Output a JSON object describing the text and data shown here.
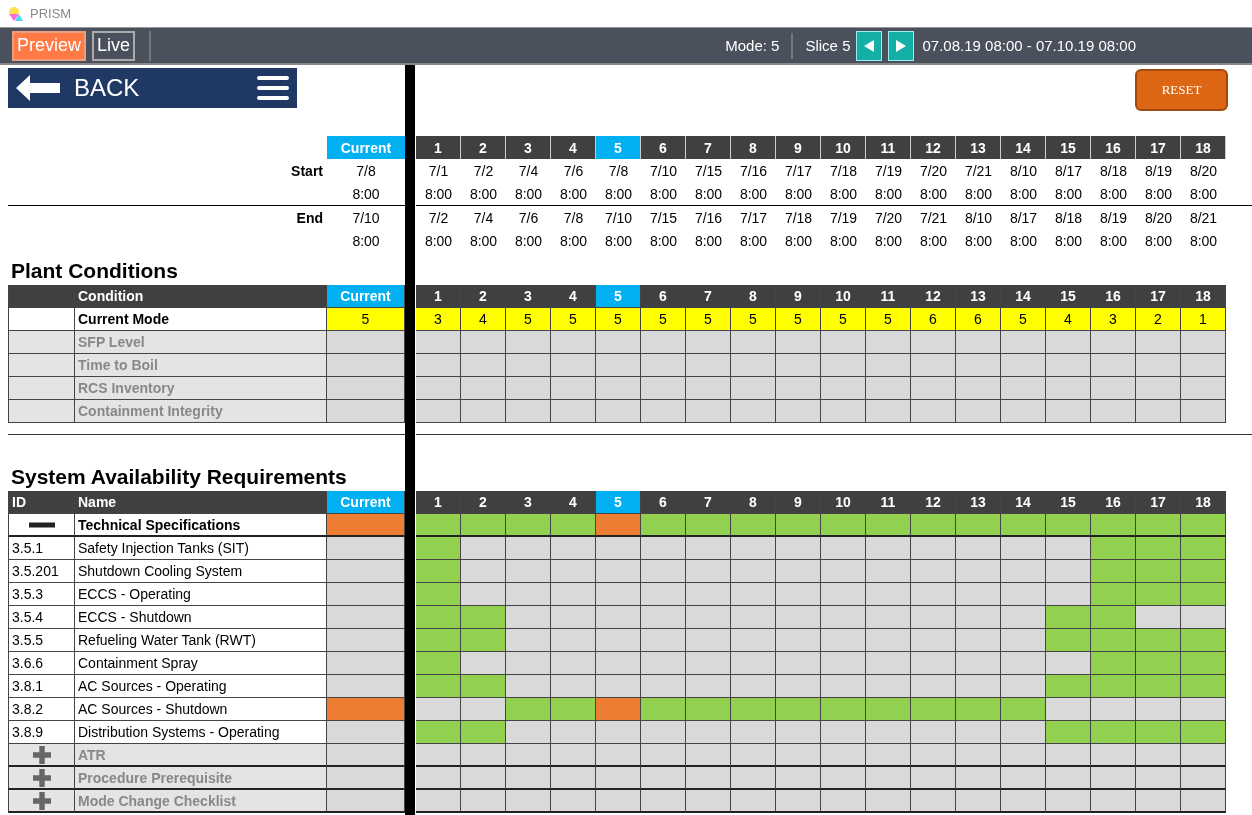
{
  "app": {
    "title": "PRISM"
  },
  "toolbar": {
    "modes": [
      {
        "label": "Preview",
        "selected": true
      },
      {
        "label": "Live",
        "selected": false
      }
    ],
    "mode": "Mode: 5",
    "slice": "Slice 5",
    "date_range": "07.08.19 08:00 - 07.10.19 08:00"
  },
  "back_button": "BACK",
  "reset_button": "RESET",
  "slices": {
    "current_label": "Current",
    "columns": [
      {
        "label": "1",
        "selected": false
      },
      {
        "label": "2",
        "selected": false
      },
      {
        "label": "3",
        "selected": false
      },
      {
        "label": "4",
        "selected": false
      },
      {
        "label": "5",
        "selected": true
      },
      {
        "label": "6",
        "selected": false
      },
      {
        "label": "7",
        "selected": false
      },
      {
        "label": "8",
        "selected": false
      },
      {
        "label": "9",
        "selected": false
      },
      {
        "label": "10",
        "selected": false
      },
      {
        "label": "11",
        "selected": false
      },
      {
        "label": "12",
        "selected": false
      },
      {
        "label": "13",
        "selected": false
      },
      {
        "label": "14",
        "selected": false
      },
      {
        "label": "15",
        "selected": false
      },
      {
        "label": "16",
        "selected": false
      },
      {
        "label": "17",
        "selected": false
      },
      {
        "label": "18",
        "selected": false
      }
    ],
    "times": [
      {
        "label": "Start",
        "current": {
          "date": "7/8",
          "time": "8:00"
        },
        "values": [
          {
            "date": "7/1",
            "time": "8:00"
          },
          {
            "date": "7/2",
            "time": "8:00"
          },
          {
            "date": "7/4",
            "time": "8:00"
          },
          {
            "date": "7/6",
            "time": "8:00"
          },
          {
            "date": "7/8",
            "time": "8:00"
          },
          {
            "date": "7/10",
            "time": "8:00"
          },
          {
            "date": "7/15",
            "time": "8:00"
          },
          {
            "date": "7/16",
            "time": "8:00"
          },
          {
            "date": "7/17",
            "time": "8:00"
          },
          {
            "date": "7/18",
            "time": "8:00"
          },
          {
            "date": "7/19",
            "time": "8:00"
          },
          {
            "date": "7/20",
            "time": "8:00"
          },
          {
            "date": "7/21",
            "time": "8:00"
          },
          {
            "date": "8/10",
            "time": "8:00"
          },
          {
            "date": "8/17",
            "time": "8:00"
          },
          {
            "date": "8/18",
            "time": "8:00"
          },
          {
            "date": "8/19",
            "time": "8:00"
          },
          {
            "date": "8/20",
            "time": "8:00"
          }
        ]
      },
      {
        "label": "End",
        "current": {
          "date": "7/10",
          "time": "8:00"
        },
        "values": [
          {
            "date": "7/2",
            "time": "8:00"
          },
          {
            "date": "7/4",
            "time": "8:00"
          },
          {
            "date": "7/6",
            "time": "8:00"
          },
          {
            "date": "7/8",
            "time": "8:00"
          },
          {
            "date": "7/10",
            "time": "8:00"
          },
          {
            "date": "7/15",
            "time": "8:00"
          },
          {
            "date": "7/16",
            "time": "8:00"
          },
          {
            "date": "7/17",
            "time": "8:00"
          },
          {
            "date": "7/18",
            "time": "8:00"
          },
          {
            "date": "7/19",
            "time": "8:00"
          },
          {
            "date": "7/20",
            "time": "8:00"
          },
          {
            "date": "7/21",
            "time": "8:00"
          },
          {
            "date": "8/10",
            "time": "8:00"
          },
          {
            "date": "8/17",
            "time": "8:00"
          },
          {
            "date": "8/18",
            "time": "8:00"
          },
          {
            "date": "8/19",
            "time": "8:00"
          },
          {
            "date": "8/20",
            "time": "8:00"
          },
          {
            "date": "8/21",
            "time": "8:00"
          }
        ]
      }
    ]
  },
  "plant_conditions": {
    "title": "Plant Conditions",
    "header": {
      "condition": "Condition",
      "current": "Current"
    },
    "columns": [
      {
        "label": "1",
        "selected": false
      },
      {
        "label": "2",
        "selected": false
      },
      {
        "label": "3",
        "selected": false
      },
      {
        "label": "4",
        "selected": false
      },
      {
        "label": "5",
        "selected": true
      },
      {
        "label": "6",
        "selected": false
      },
      {
        "label": "7",
        "selected": false
      },
      {
        "label": "8",
        "selected": false
      },
      {
        "label": "9",
        "selected": false
      },
      {
        "label": "10",
        "selected": false
      },
      {
        "label": "11",
        "selected": false
      },
      {
        "label": "12",
        "selected": false
      },
      {
        "label": "13",
        "selected": false
      },
      {
        "label": "14",
        "selected": false
      },
      {
        "label": "15",
        "selected": false
      },
      {
        "label": "16",
        "selected": false
      },
      {
        "label": "17",
        "selected": false
      },
      {
        "label": "18",
        "selected": false
      }
    ],
    "rows": [
      {
        "name": "Current Mode",
        "disabled": false,
        "current": "5",
        "values": [
          "3",
          "4",
          "5",
          "5",
          "5",
          "5",
          "5",
          "5",
          "5",
          "5",
          "5",
          "6",
          "6",
          "5",
          "4",
          "3",
          "2",
          "1"
        ]
      },
      {
        "name": "SFP Level",
        "disabled": true
      },
      {
        "name": "Time to Boil",
        "disabled": true
      },
      {
        "name": "RCS Inventory",
        "disabled": true
      },
      {
        "name": "Containment Integrity",
        "disabled": true
      }
    ]
  },
  "system": {
    "title": "System Availability Requirements",
    "header": {
      "id": "ID",
      "name": "Name",
      "current": "Current"
    },
    "columns": [
      {
        "label": "1",
        "selected": false
      },
      {
        "label": "2",
        "selected": false
      },
      {
        "label": "3",
        "selected": false
      },
      {
        "label": "4",
        "selected": false
      },
      {
        "label": "5",
        "selected": true
      },
      {
        "label": "6",
        "selected": false
      },
      {
        "label": "7",
        "selected": false
      },
      {
        "label": "8",
        "selected": false
      },
      {
        "label": "9",
        "selected": false
      },
      {
        "label": "10",
        "selected": false
      },
      {
        "label": "11",
        "selected": false
      },
      {
        "label": "12",
        "selected": false
      },
      {
        "label": "13",
        "selected": false
      },
      {
        "label": "14",
        "selected": false
      },
      {
        "label": "15",
        "selected": false
      },
      {
        "label": "16",
        "selected": false
      },
      {
        "label": "17",
        "selected": false
      },
      {
        "label": "18",
        "selected": false
      }
    ],
    "groups": [
      {
        "name": "Technical Specifications",
        "expanded": true,
        "current": {
          "color": "#ed7d31"
        },
        "cells": [
          {
            "color": "#92d050"
          },
          {
            "color": "#92d050"
          },
          {
            "color": "#92d050"
          },
          {
            "color": "#92d050"
          },
          {
            "color": "#ed7d31"
          },
          {
            "color": "#92d050"
          },
          {
            "color": "#92d050"
          },
          {
            "color": "#92d050"
          },
          {
            "color": "#92d050"
          },
          {
            "color": "#92d050"
          },
          {
            "color": "#92d050"
          },
          {
            "color": "#92d050"
          },
          {
            "color": "#92d050"
          },
          {
            "color": "#92d050"
          },
          {
            "color": "#92d050"
          },
          {
            "color": "#92d050"
          },
          {
            "color": "#92d050"
          },
          {
            "color": "#92d050"
          }
        ],
        "rows": [
          {
            "id": "3.5.1",
            "name": "Safety Injection Tanks (SIT)",
            "current": {
              "color": "#d9d9d9"
            },
            "cells": [
              {
                "color": "#92d050"
              },
              {
                "color": "#d9d9d9"
              },
              {
                "color": "#d9d9d9"
              },
              {
                "color": "#d9d9d9"
              },
              {
                "color": "#d9d9d9"
              },
              {
                "color": "#d9d9d9"
              },
              {
                "color": "#d9d9d9"
              },
              {
                "color": "#d9d9d9"
              },
              {
                "color": "#d9d9d9"
              },
              {
                "color": "#d9d9d9"
              },
              {
                "color": "#d9d9d9"
              },
              {
                "color": "#d9d9d9"
              },
              {
                "color": "#d9d9d9"
              },
              {
                "color": "#d9d9d9"
              },
              {
                "color": "#d9d9d9"
              },
              {
                "color": "#92d050"
              },
              {
                "color": "#92d050"
              },
              {
                "color": "#92d050"
              }
            ]
          },
          {
            "id": "3.5.201",
            "name": "Shutdown Cooling System",
            "current": {
              "color": "#d9d9d9"
            },
            "cells": [
              {
                "color": "#92d050"
              },
              {
                "color": "#d9d9d9"
              },
              {
                "color": "#d9d9d9"
              },
              {
                "color": "#d9d9d9"
              },
              {
                "color": "#d9d9d9"
              },
              {
                "color": "#d9d9d9"
              },
              {
                "color": "#d9d9d9"
              },
              {
                "color": "#d9d9d9"
              },
              {
                "color": "#d9d9d9"
              },
              {
                "color": "#d9d9d9"
              },
              {
                "color": "#d9d9d9"
              },
              {
                "color": "#d9d9d9"
              },
              {
                "color": "#d9d9d9"
              },
              {
                "color": "#d9d9d9"
              },
              {
                "color": "#d9d9d9"
              },
              {
                "color": "#92d050"
              },
              {
                "color": "#92d050"
              },
              {
                "color": "#92d050"
              }
            ]
          },
          {
            "id": "3.5.3",
            "name": "ECCS - Operating",
            "current": {
              "color": "#d9d9d9"
            },
            "cells": [
              {
                "color": "#92d050"
              },
              {
                "color": "#d9d9d9"
              },
              {
                "color": "#d9d9d9"
              },
              {
                "color": "#d9d9d9"
              },
              {
                "color": "#d9d9d9"
              },
              {
                "color": "#d9d9d9"
              },
              {
                "color": "#d9d9d9"
              },
              {
                "color": "#d9d9d9"
              },
              {
                "color": "#d9d9d9"
              },
              {
                "color": "#d9d9d9"
              },
              {
                "color": "#d9d9d9"
              },
              {
                "color": "#d9d9d9"
              },
              {
                "color": "#d9d9d9"
              },
              {
                "color": "#d9d9d9"
              },
              {
                "color": "#d9d9d9"
              },
              {
                "color": "#92d050"
              },
              {
                "color": "#92d050"
              },
              {
                "color": "#92d050"
              }
            ]
          },
          {
            "id": "3.5.4",
            "name": "ECCS - Shutdown",
            "current": {
              "color": "#d9d9d9"
            },
            "cells": [
              {
                "color": "#92d050"
              },
              {
                "color": "#92d050"
              },
              {
                "color": "#d9d9d9"
              },
              {
                "color": "#d9d9d9"
              },
              {
                "color": "#d9d9d9"
              },
              {
                "color": "#d9d9d9"
              },
              {
                "color": "#d9d9d9"
              },
              {
                "color": "#d9d9d9"
              },
              {
                "color": "#d9d9d9"
              },
              {
                "color": "#d9d9d9"
              },
              {
                "color": "#d9d9d9"
              },
              {
                "color": "#d9d9d9"
              },
              {
                "color": "#d9d9d9"
              },
              {
                "color": "#d9d9d9"
              },
              {
                "color": "#92d050"
              },
              {
                "color": "#92d050"
              },
              {
                "color": "#d9d9d9"
              },
              {
                "color": "#d9d9d9"
              }
            ]
          },
          {
            "id": "3.5.5",
            "name": "Refueling Water Tank (RWT)",
            "current": {
              "color": "#d9d9d9"
            },
            "cells": [
              {
                "color": "#92d050"
              },
              {
                "color": "#92d050"
              },
              {
                "color": "#d9d9d9"
              },
              {
                "color": "#d9d9d9"
              },
              {
                "color": "#d9d9d9"
              },
              {
                "color": "#d9d9d9"
              },
              {
                "color": "#d9d9d9"
              },
              {
                "color": "#d9d9d9"
              },
              {
                "color": "#d9d9d9"
              },
              {
                "color": "#d9d9d9"
              },
              {
                "color": "#d9d9d9"
              },
              {
                "color": "#d9d9d9"
              },
              {
                "color": "#d9d9d9"
              },
              {
                "color": "#d9d9d9"
              },
              {
                "color": "#92d050"
              },
              {
                "color": "#92d050"
              },
              {
                "color": "#92d050"
              },
              {
                "color": "#92d050"
              }
            ]
          },
          {
            "id": "3.6.6",
            "name": "Containment Spray",
            "current": {
              "color": "#d9d9d9"
            },
            "cells": [
              {
                "color": "#92d050"
              },
              {
                "color": "#d9d9d9"
              },
              {
                "color": "#d9d9d9"
              },
              {
                "color": "#d9d9d9"
              },
              {
                "color": "#d9d9d9"
              },
              {
                "color": "#d9d9d9"
              },
              {
                "color": "#d9d9d9"
              },
              {
                "color": "#d9d9d9"
              },
              {
                "color": "#d9d9d9"
              },
              {
                "color": "#d9d9d9"
              },
              {
                "color": "#d9d9d9"
              },
              {
                "color": "#d9d9d9"
              },
              {
                "color": "#d9d9d9"
              },
              {
                "color": "#d9d9d9"
              },
              {
                "color": "#d9d9d9"
              },
              {
                "color": "#92d050"
              },
              {
                "color": "#92d050"
              },
              {
                "color": "#92d050"
              }
            ]
          },
          {
            "id": "3.8.1",
            "name": "AC Sources - Operating",
            "current": {
              "color": "#d9d9d9"
            },
            "cells": [
              {
                "color": "#92d050"
              },
              {
                "color": "#92d050"
              },
              {
                "color": "#d9d9d9"
              },
              {
                "color": "#d9d9d9"
              },
              {
                "color": "#d9d9d9"
              },
              {
                "color": "#d9d9d9"
              },
              {
                "color": "#d9d9d9"
              },
              {
                "color": "#d9d9d9"
              },
              {
                "color": "#d9d9d9"
              },
              {
                "color": "#d9d9d9"
              },
              {
                "color": "#d9d9d9"
              },
              {
                "color": "#d9d9d9"
              },
              {
                "color": "#d9d9d9"
              },
              {
                "color": "#d9d9d9"
              },
              {
                "color": "#92d050"
              },
              {
                "color": "#92d050"
              },
              {
                "color": "#92d050"
              },
              {
                "color": "#92d050"
              }
            ]
          },
          {
            "id": "3.8.2",
            "name": "AC Sources - Shutdown",
            "current": {
              "color": "#ed7d31"
            },
            "cells": [
              {
                "color": "#d9d9d9"
              },
              {
                "color": "#d9d9d9"
              },
              {
                "color": "#92d050"
              },
              {
                "color": "#92d050"
              },
              {
                "color": "#ed7d31"
              },
              {
                "color": "#92d050"
              },
              {
                "color": "#92d050"
              },
              {
                "color": "#92d050"
              },
              {
                "color": "#92d050"
              },
              {
                "color": "#92d050"
              },
              {
                "color": "#92d050"
              },
              {
                "color": "#92d050"
              },
              {
                "color": "#92d050"
              },
              {
                "color": "#92d050"
              },
              {
                "color": "#d9d9d9"
              },
              {
                "color": "#d9d9d9"
              },
              {
                "color": "#d9d9d9"
              },
              {
                "color": "#d9d9d9"
              }
            ]
          },
          {
            "id": "3.8.9",
            "name": "Distribution Systems - Operating",
            "current": {
              "color": "#d9d9d9"
            },
            "cells": [
              {
                "color": "#92d050"
              },
              {
                "color": "#92d050"
              },
              {
                "color": "#d9d9d9"
              },
              {
                "color": "#d9d9d9"
              },
              {
                "color": "#d9d9d9"
              },
              {
                "color": "#d9d9d9"
              },
              {
                "color": "#d9d9d9"
              },
              {
                "color": "#d9d9d9"
              },
              {
                "color": "#d9d9d9"
              },
              {
                "color": "#d9d9d9"
              },
              {
                "color": "#d9d9d9"
              },
              {
                "color": "#d9d9d9"
              },
              {
                "color": "#d9d9d9"
              },
              {
                "color": "#d9d9d9"
              },
              {
                "color": "#92d050"
              },
              {
                "color": "#92d050"
              },
              {
                "color": "#92d050"
              },
              {
                "color": "#92d050"
              }
            ]
          }
        ]
      },
      {
        "name": "ATR",
        "expanded": false
      },
      {
        "name": "Procedure Prerequisite",
        "expanded": false
      },
      {
        "name": "Mode Change Checklist",
        "expanded": false
      }
    ]
  }
}
